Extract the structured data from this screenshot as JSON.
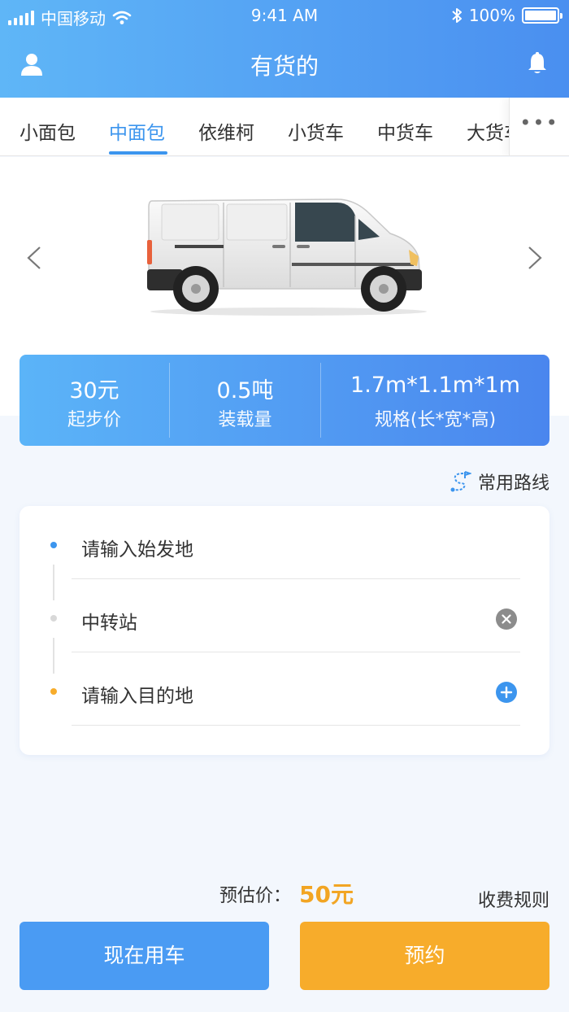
{
  "status_bar": {
    "carrier": "中国移动",
    "time": "9:41 AM",
    "battery": "100%"
  },
  "header": {
    "title": "有货的",
    "left_icon": "user-icon",
    "right_icon": "bell-icon"
  },
  "tabs": {
    "items": [
      "小面包",
      "中面包",
      "依维柯",
      "小货车",
      "中货车",
      "大货车"
    ],
    "active_index": 1,
    "more_label": "•••"
  },
  "vehicle": {
    "image": "white-van",
    "prev_icon": "chevron-left-icon",
    "next_icon": "chevron-right-icon"
  },
  "specs": [
    {
      "value": "30元",
      "label": "起步价"
    },
    {
      "value": "0.5吨",
      "label": "装载量"
    },
    {
      "value": "1.7m*1.1m*1m",
      "label": "规格(长*宽*高)"
    }
  ],
  "common_route": {
    "label": "常用路线",
    "icon": "route-icon"
  },
  "addresses": {
    "origin_placeholder": "请输入始发地",
    "transit": "中转站",
    "destination_placeholder": "请输入目的地"
  },
  "pricing": {
    "label": "预估价：",
    "value": "50元",
    "rules_link": "收费规则"
  },
  "actions": {
    "now_label": "现在用车",
    "book_label": "预约"
  },
  "colors": {
    "primary": "#3c95ee",
    "accent_orange": "#f7ac2b",
    "price_orange": "#f2a523",
    "origin_dot": "#3c95ee",
    "transit_dot": "#d8d8d8",
    "dest_dot": "#f7ac2b"
  }
}
